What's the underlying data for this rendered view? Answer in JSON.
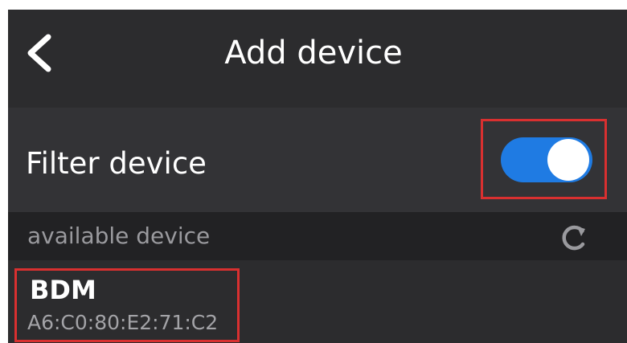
{
  "header": {
    "title": "Add device",
    "back_icon": "chevron-left-icon"
  },
  "filter": {
    "label": "Filter device",
    "enabled": true,
    "toggle_color": "#1f7be3"
  },
  "available": {
    "section_label": "available device",
    "refresh_icon": "refresh-icon"
  },
  "devices": [
    {
      "name": "BDM",
      "mac": "A6:C0:80:E2:71:C2"
    }
  ],
  "colors": {
    "background": "#2c2c2e",
    "highlight_border": "#d93030"
  }
}
